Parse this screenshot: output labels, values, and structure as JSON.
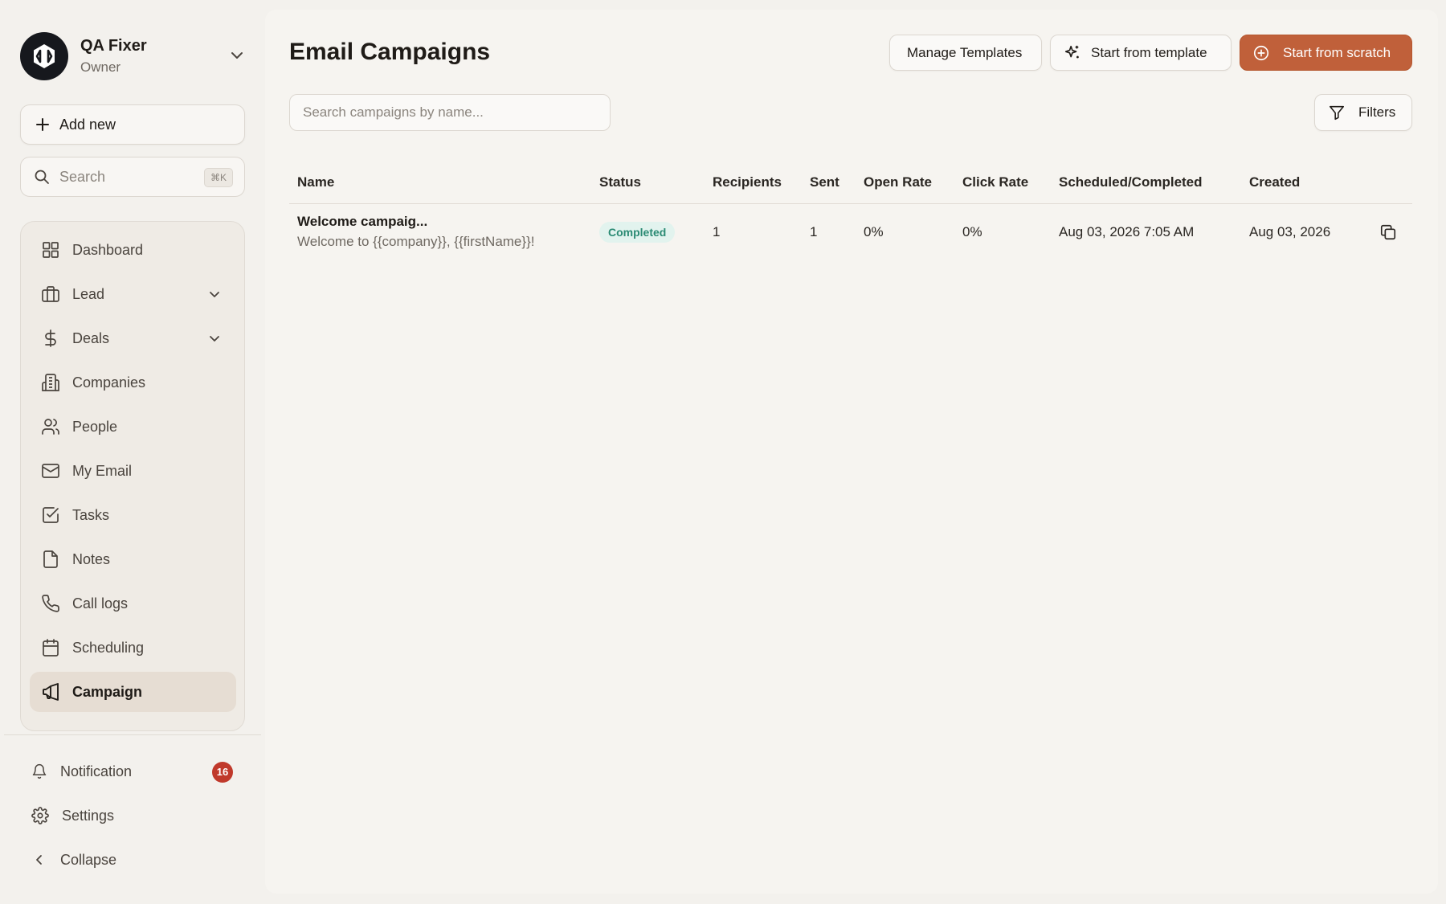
{
  "workspace": {
    "name": "QA Fixer",
    "role": "Owner"
  },
  "sidebar": {
    "add_new_label": "Add new",
    "search_label": "Search",
    "search_shortcut": "⌘K",
    "items": [
      {
        "label": "Dashboard",
        "icon": "dashboard-icon"
      },
      {
        "label": "Lead",
        "icon": "briefcase-icon",
        "expandable": true
      },
      {
        "label": "Deals",
        "icon": "dollar-icon",
        "expandable": true
      },
      {
        "label": "Companies",
        "icon": "building-icon"
      },
      {
        "label": "People",
        "icon": "people-icon"
      },
      {
        "label": "My Email",
        "icon": "mail-icon"
      },
      {
        "label": "Tasks",
        "icon": "checkbox-icon"
      },
      {
        "label": "Notes",
        "icon": "note-icon"
      },
      {
        "label": "Call logs",
        "icon": "phone-icon"
      },
      {
        "label": "Scheduling",
        "icon": "calendar-icon"
      },
      {
        "label": "Campaign",
        "icon": "megaphone-icon",
        "active": true
      }
    ],
    "notification_label": "Notification",
    "notification_count": "16",
    "settings_label": "Settings",
    "collapse_label": "Collapse"
  },
  "main": {
    "title": "Email Campaigns",
    "manage_templates_label": "Manage Templates",
    "start_from_template_label": "Start from template",
    "start_from_scratch_label": "Start from scratch",
    "search_placeholder": "Search campaigns by name...",
    "filters_label": "Filters"
  },
  "table": {
    "columns": [
      "Name",
      "Status",
      "Recipients",
      "Sent",
      "Open Rate",
      "Click Rate",
      "Scheduled/Completed",
      "Created"
    ],
    "rows": [
      {
        "name": "Welcome campaig...",
        "subject": "Welcome to {{company}}, {{firstName}}!",
        "status": "Completed",
        "recipients": "1",
        "sent": "1",
        "open_rate": "0%",
        "click_rate": "0%",
        "scheduled_completed": "Aug 03, 2026 7:05 AM",
        "created": "Aug 03, 2026"
      }
    ]
  },
  "colors": {
    "accent": "#c0603a",
    "status_completed_bg": "#e2f3ee",
    "status_completed_text": "#2a8a73",
    "badge": "#c0392b"
  }
}
